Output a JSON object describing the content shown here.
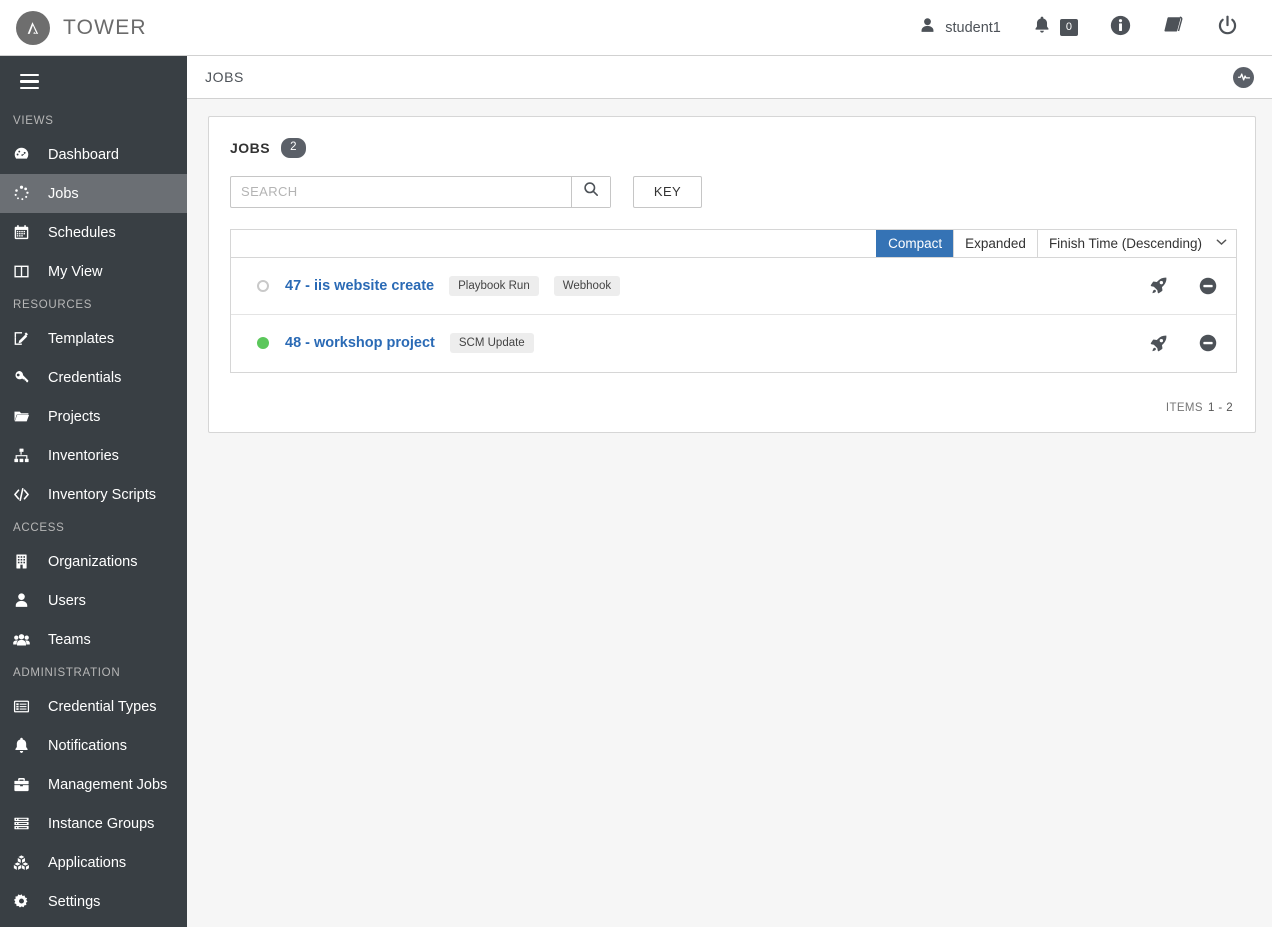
{
  "header": {
    "brand": "TOWER",
    "brand_icon": "ansible-logo-icon",
    "user": {
      "name": "student1",
      "icon": "user-icon"
    },
    "notifications": {
      "icon": "bell-icon",
      "count": "0"
    },
    "info_icon": "info-circle-icon",
    "docs_icon": "book-icon",
    "logout_icon": "power-icon"
  },
  "sidebar": {
    "toggle_icon": "hamburger-icon",
    "sections": [
      {
        "title": "VIEWS",
        "items": [
          {
            "label": "Dashboard",
            "icon": "dashboard-icon",
            "active": false
          },
          {
            "label": "Jobs",
            "icon": "jobs-spinner-icon",
            "active": true
          },
          {
            "label": "Schedules",
            "icon": "calendar-icon",
            "active": false
          },
          {
            "label": "My View",
            "icon": "columns-icon",
            "active": false
          }
        ]
      },
      {
        "title": "RESOURCES",
        "items": [
          {
            "label": "Templates",
            "icon": "pencil-square-icon",
            "active": false
          },
          {
            "label": "Credentials",
            "icon": "key-icon",
            "active": false
          },
          {
            "label": "Projects",
            "icon": "folder-icon",
            "active": false
          },
          {
            "label": "Inventories",
            "icon": "sitemap-icon",
            "active": false
          },
          {
            "label": "Inventory Scripts",
            "icon": "code-icon",
            "active": false
          }
        ]
      },
      {
        "title": "ACCESS",
        "items": [
          {
            "label": "Organizations",
            "icon": "building-icon",
            "active": false
          },
          {
            "label": "Users",
            "icon": "user-icon",
            "active": false
          },
          {
            "label": "Teams",
            "icon": "users-group-icon",
            "active": false
          }
        ]
      },
      {
        "title": "ADMINISTRATION",
        "items": [
          {
            "label": "Credential Types",
            "icon": "list-alt-icon",
            "active": false
          },
          {
            "label": "Notifications",
            "icon": "bell-icon",
            "active": false
          },
          {
            "label": "Management Jobs",
            "icon": "briefcase-icon",
            "active": false
          },
          {
            "label": "Instance Groups",
            "icon": "server-icon",
            "active": false
          },
          {
            "label": "Applications",
            "icon": "cubes-icon",
            "active": false
          },
          {
            "label": "Settings",
            "icon": "gear-icon",
            "active": false
          }
        ]
      }
    ]
  },
  "breadcrumb": {
    "title": "JOBS",
    "activity_stream_icon": "activity-pulse-icon"
  },
  "jobs_panel": {
    "title": "JOBS",
    "count": "2",
    "search": {
      "placeholder": "SEARCH",
      "value": "",
      "search_icon": "magnifier-icon"
    },
    "key_button": "KEY",
    "toolbar": {
      "compact_label": "Compact",
      "expanded_label": "Expanded",
      "selected_view": "Compact",
      "sort_label": "Finish Time (Descending)",
      "sort_chevron_icon": "chevron-down-icon"
    },
    "rows": [
      {
        "status": "pending",
        "status_color": "#c9c9c9",
        "name": "47 - iis website create",
        "tags": [
          "Playbook Run",
          "Webhook"
        ],
        "actions": [
          {
            "icon": "rocket-icon",
            "title": "relaunch"
          },
          {
            "icon": "circle-minus-icon",
            "title": "cancel"
          }
        ]
      },
      {
        "status": "successful",
        "status_color": "#5bc75b",
        "name": "48 - workshop project",
        "tags": [
          "SCM Update"
        ],
        "actions": [
          {
            "icon": "rocket-icon",
            "title": "relaunch"
          },
          {
            "icon": "circle-minus-icon",
            "title": "cancel"
          }
        ]
      }
    ],
    "footer": {
      "items_label": "ITEMS",
      "range": "1 - 2"
    }
  },
  "colors": {
    "accent_blue": "#3573b5",
    "link_blue": "#2a6ab5",
    "sidebar_bg": "#393f44",
    "sidebar_active": "#6b6f74",
    "success_green": "#5bc75b",
    "badge_gray": "#5b6068"
  }
}
